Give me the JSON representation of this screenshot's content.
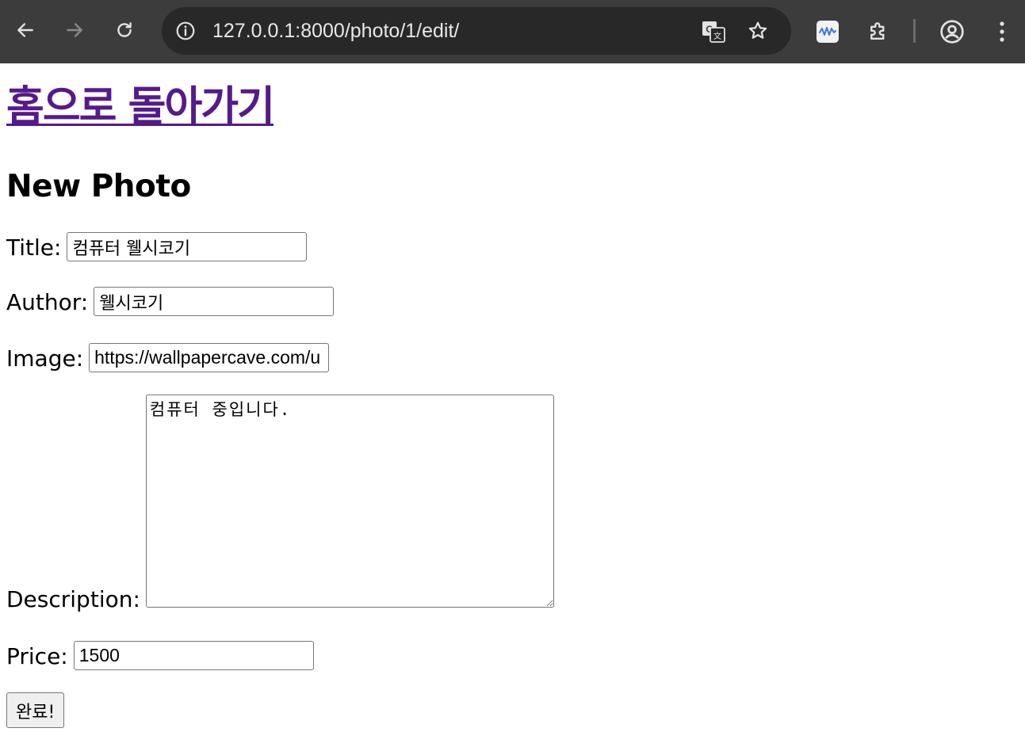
{
  "browser": {
    "url": "127.0.0.1:8000/photo/1/edit/",
    "icons": {
      "back": "back-arrow-icon",
      "forward": "forward-arrow-icon",
      "reload": "reload-icon",
      "site_info": "info-icon",
      "translate": "translate-icon",
      "bookmark": "star-icon",
      "extension_app": "wave-extension-icon",
      "extensions": "puzzle-icon",
      "profile": "profile-icon",
      "menu": "kebab-menu-icon"
    },
    "colors": {
      "chrome_bg": "#3c3c3c",
      "omnibox_bg": "#282828",
      "url_text": "#e8e8e8"
    }
  },
  "page": {
    "home_link": "홈으로 돌아가기",
    "title": "New Photo",
    "link_color": "#551a8b"
  },
  "form": {
    "title": {
      "label": "Title:",
      "value": "컴퓨터 웰시코기"
    },
    "author": {
      "label": "Author:",
      "value": "웰시코기"
    },
    "image": {
      "label": "Image:",
      "value": "https://wallpapercave.com/u"
    },
    "description": {
      "label": "Description:",
      "value": "컴퓨터 중입니다."
    },
    "price": {
      "label": "Price:",
      "value": "1500"
    },
    "submit_label": "완료!"
  }
}
